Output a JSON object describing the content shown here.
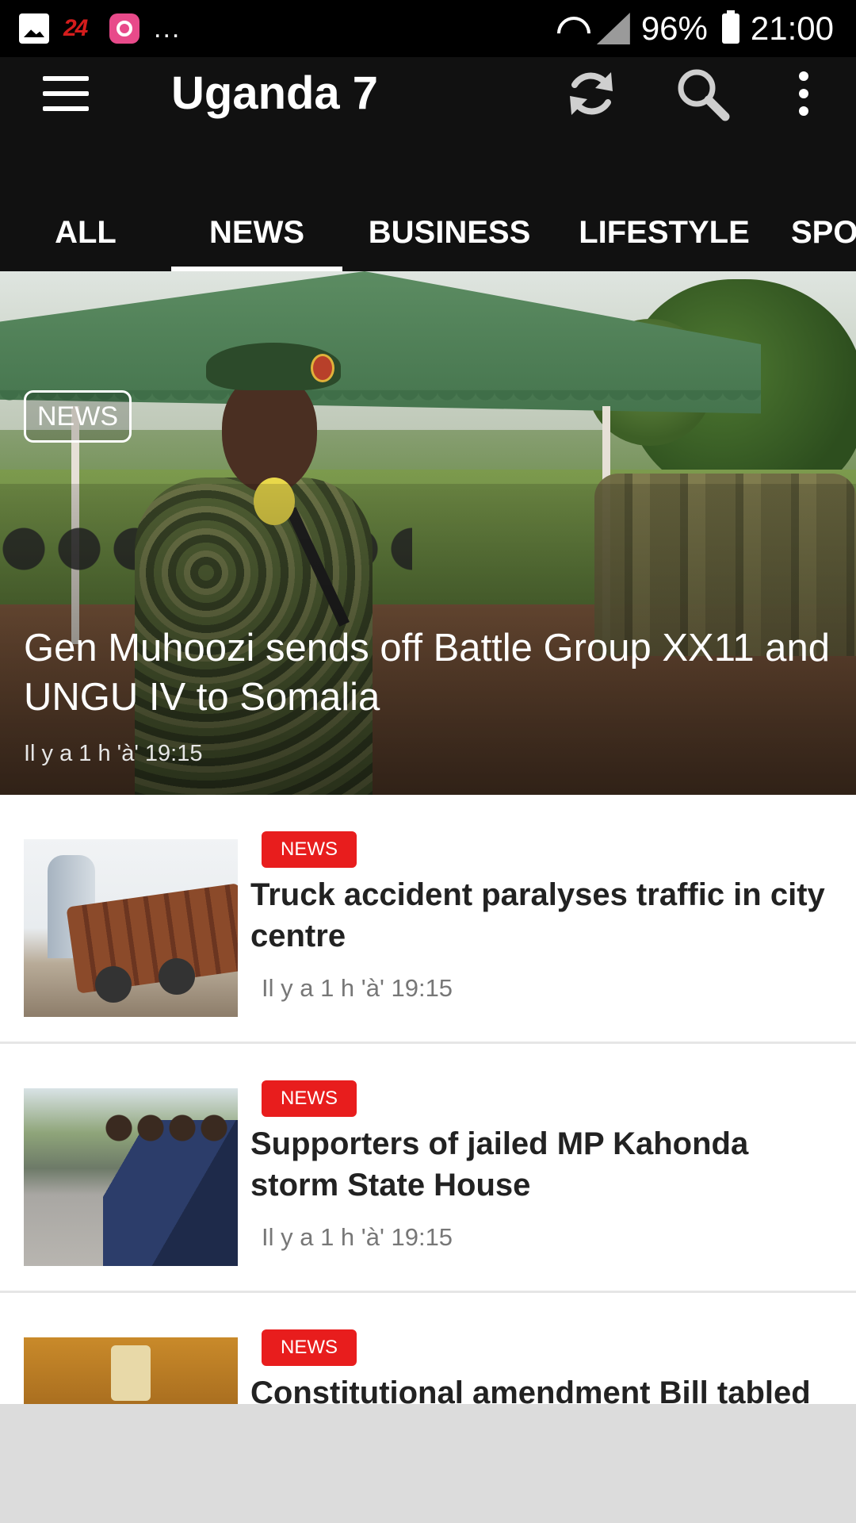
{
  "status_bar": {
    "dots": "...",
    "battery": "96%",
    "time": "21:00",
    "icons": [
      "gallery-icon",
      "app-24-icon",
      "notification-app-icon",
      "wifi-icon",
      "signal-icon",
      "battery-icon"
    ]
  },
  "app_bar": {
    "title": "Uganda 7",
    "icons": [
      "menu-icon",
      "refresh-icon",
      "search-icon",
      "more-vert-icon"
    ]
  },
  "tabs": [
    {
      "label": "ALL",
      "active": false
    },
    {
      "label": "NEWS",
      "active": true
    },
    {
      "label": "BUSINESS",
      "active": false
    },
    {
      "label": "LIFESTYLE",
      "active": false
    },
    {
      "label": "SPO",
      "active": false
    }
  ],
  "hero": {
    "badge": "NEWS",
    "title": "Gen Muhoozi sends off Battle Group XX11 and UNGU IV to Somalia",
    "time": "Il y a 1 h 'à' 19:15"
  },
  "articles": [
    {
      "badge": "NEWS",
      "title": "Truck accident paralyses traffic in city centre",
      "time": "Il y a 1 h 'à' 19:15"
    },
    {
      "badge": "NEWS",
      "title": "Supporters of jailed MP Kahonda storm State House",
      "time": "Il y a 1 h 'à' 19:15"
    },
    {
      "badge": "NEWS",
      "title": "Constitutional amendment Bill tabled",
      "time": ""
    }
  ],
  "colors": {
    "app_bar": "#111111",
    "badge_red": "#e81d1d",
    "status_bar": "#000000"
  }
}
